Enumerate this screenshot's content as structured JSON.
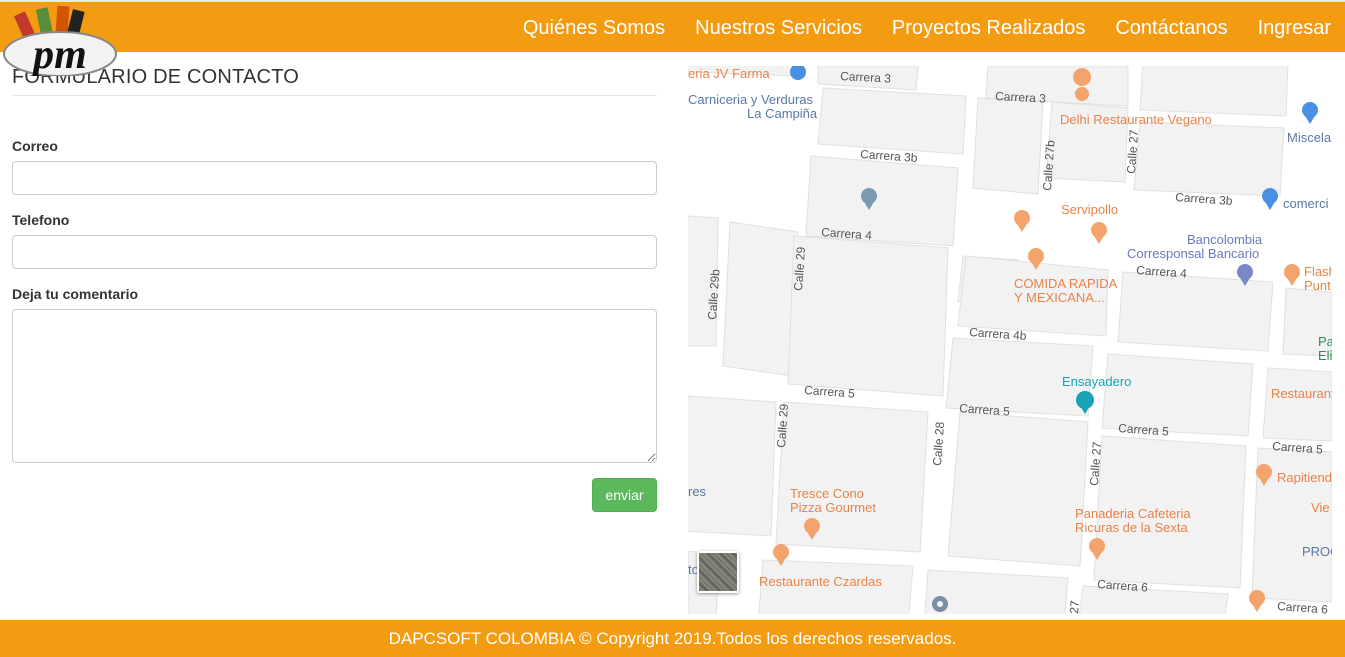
{
  "header": {
    "logo_text": "pm",
    "nav": [
      {
        "label": "Quiénes Somos"
      },
      {
        "label": "Nuestros Servicios"
      },
      {
        "label": "Proyectos Realizados"
      },
      {
        "label": "Contáctanos"
      },
      {
        "label": "Ingresar"
      }
    ]
  },
  "form": {
    "title": "FORMULARIO DE CONTACTO",
    "email_label": "Correo",
    "phone_label": "Telefono",
    "comment_label": "Deja tu comentario",
    "submit_label": "enviar"
  },
  "map": {
    "streets": [
      "Carrera 3",
      "Carrera 3",
      "Carrera 3b",
      "Carrera 3b",
      "Carrera 4",
      "Carrera 4",
      "Carrera 4b",
      "Carrera 5",
      "Carrera 5",
      "Carrera 5",
      "Carrera 5",
      "Carrera 6",
      "Carrera 6",
      "Calle 29b",
      "Calle 29",
      "Calle 29",
      "Calle 28",
      "Calle 27",
      "Calle 27b",
      "Calle 27",
      "27"
    ],
    "places": [
      "eria JV Farma",
      "Carniceria y Verduras",
      "La Campiña",
      "Delhi Restaurante Vegano",
      "Miscela",
      "Servipollo",
      "comerci",
      "Bancolombia",
      "Corresponsal Bancario",
      "Flash",
      "Punt",
      "COMIDA RAPIDA",
      "Y MEXICANA...",
      "Pa",
      "Eli",
      "Ensayadero",
      "Restaurant",
      "Rapitiend",
      "Vie",
      "Tresce Cono",
      "Pizza Gourmet",
      "Panaderia Cafeteria",
      "Ricuras de la Sexta",
      "PROC",
      "Restaurante Czardas",
      "res",
      "to"
    ],
    "colors": {
      "background": "#e5e3df",
      "road": "#ffffff",
      "block": "#f2f2f2",
      "food": "#e8834a",
      "shop": "#3b82f6",
      "bank": "#6a78c2",
      "music": "#17a2b8",
      "park": "#2e8b57"
    }
  },
  "footer": {
    "text": "DAPCSOFT COLOMBIA © Copyright 2019.Todos los derechos reservados."
  },
  "colors": {
    "brand": "#f39c12",
    "button": "#5cb85c"
  }
}
